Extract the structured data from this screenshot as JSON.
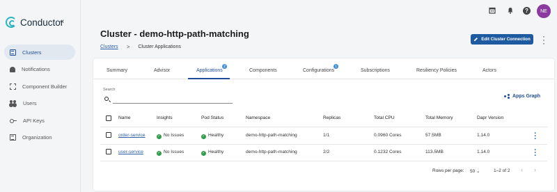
{
  "sidebar": {
    "logo_text": "Conductor",
    "collapse_icon": "«",
    "items": [
      {
        "label": "Clusters",
        "icon": "clusters-icon",
        "active": true
      },
      {
        "label": "Notifications",
        "icon": "bell-icon"
      },
      {
        "label": "Component Builder",
        "icon": "builder-icon"
      },
      {
        "label": "Users",
        "icon": "users-icon"
      },
      {
        "label": "API Keys",
        "icon": "key-icon"
      },
      {
        "label": "Organization",
        "icon": "organization-icon"
      }
    ]
  },
  "topbar": {
    "avatar_initials": "NE",
    "help_glyph": "?",
    "avatar_color": "#8a3a9f"
  },
  "header": {
    "title": "Cluster - demo-http-path-matching",
    "breadcrumb": {
      "link": "Clusters",
      "separator": ">",
      "current": "Cluster Applications"
    },
    "edit_button": "Edit Cluster Connection"
  },
  "tabs": [
    {
      "label": "Summary"
    },
    {
      "label": "Advisor"
    },
    {
      "label": "Applications",
      "badge": "2",
      "active": true
    },
    {
      "label": "Components"
    },
    {
      "label": "Configurations",
      "badge": "1"
    },
    {
      "label": "Subscriptions"
    },
    {
      "label": "Resiliency Policies"
    },
    {
      "label": "Actors"
    }
  ],
  "search": {
    "label": "Search",
    "value": ""
  },
  "apps_graph": "Apps Graph",
  "table": {
    "columns": [
      "Name",
      "Insights",
      "Pod Status",
      "Namespace",
      "Replicas",
      "Total CPU",
      "Total Memory",
      "Dapr Version"
    ],
    "rows": [
      [
        "order-service",
        "No Issues",
        "Healthy",
        "demo-http-path-matching",
        "1/1",
        "0.0960 Cores",
        "57.5MB",
        "1.14.0"
      ],
      [
        "user-service",
        "No Issues",
        "Healthy",
        "demo-http-path-matching",
        "2/2",
        "0.1232 Cores",
        "113.5MB",
        "1.14.0"
      ]
    ]
  },
  "pagination": {
    "rows_per_page_label": "Rows per page:",
    "rows_per_page": "50",
    "range": "1–2 of 2"
  },
  "colors": {
    "accent": "#1e5aa0",
    "healthy": "#2e9e47",
    "badge": "#3d8fdc"
  }
}
